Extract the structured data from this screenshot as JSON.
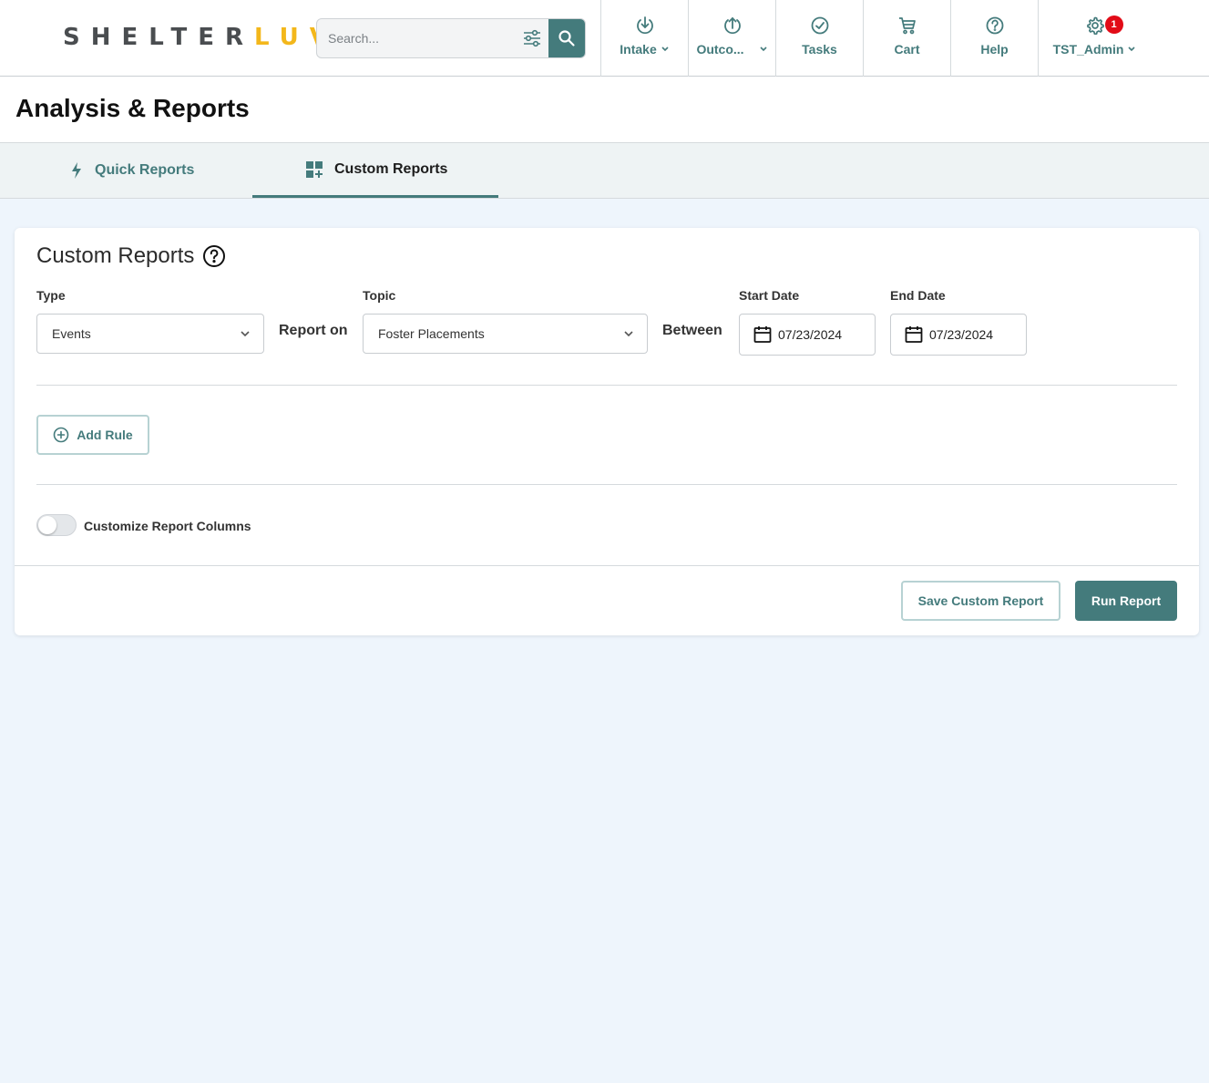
{
  "brand": {
    "logo_part1": "SHELTER",
    "logo_part2": "LUV"
  },
  "search": {
    "placeholder": "Search..."
  },
  "nav": {
    "intake": "Intake",
    "outcomes": "Outco...",
    "tasks": "Tasks",
    "cart": "Cart",
    "help": "Help",
    "admin": "TST_Admin",
    "notification_count": "1"
  },
  "page": {
    "title": "Analysis & Reports"
  },
  "tabs": {
    "quick": "Quick Reports",
    "custom": "Custom Reports"
  },
  "card": {
    "title": "Custom Reports",
    "type_label": "Type",
    "type_value": "Events",
    "report_on": "Report on",
    "topic_label": "Topic",
    "topic_value": "Foster Placements",
    "between": "Between",
    "start_label": "Start Date",
    "start_value": "07/23/2024",
    "end_label": "End Date",
    "end_value": "07/23/2024",
    "add_rule": "Add Rule",
    "customize_columns": "Customize Report Columns",
    "save_button": "Save Custom Report",
    "run_button": "Run Report"
  },
  "colors": {
    "accent": "#447b7c",
    "brand_yellow": "#f3b71b",
    "badge_red": "#e20b17",
    "page_bg": "#eef5fc"
  }
}
